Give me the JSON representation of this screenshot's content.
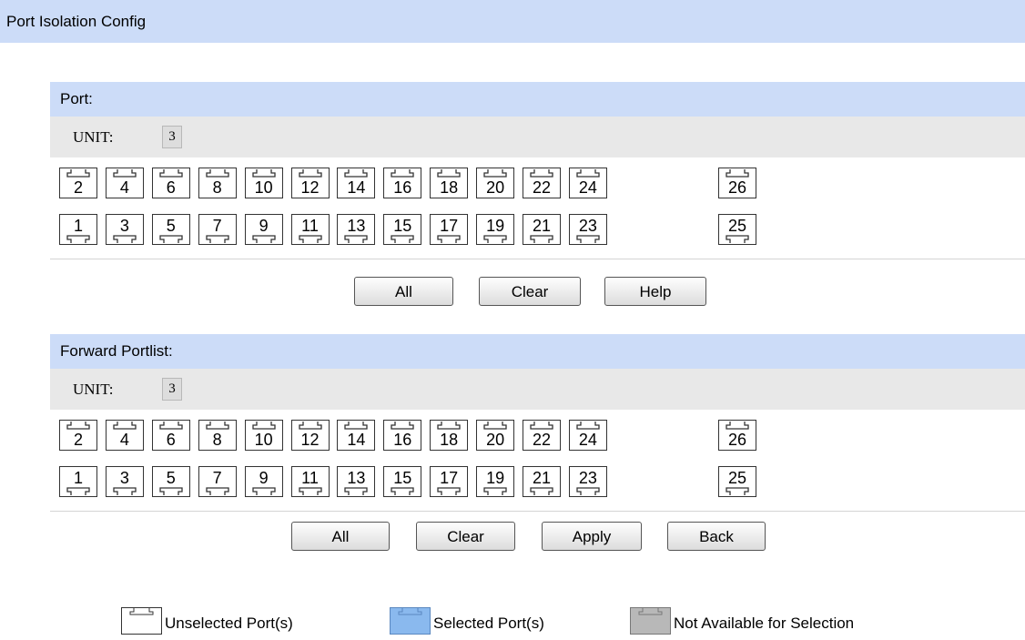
{
  "page_title": "Port Isolation Config",
  "port_section": {
    "header": "Port:",
    "unit_label": "UNIT:",
    "unit_value": "3",
    "buttons": {
      "all": "All",
      "clear": "Clear",
      "help": "Help"
    }
  },
  "forward_section": {
    "header": "Forward Portlist:",
    "unit_label": "UNIT:",
    "unit_value": "3",
    "buttons": {
      "all": "All",
      "clear": "Clear",
      "apply": "Apply",
      "back": "Back"
    }
  },
  "ports": {
    "top_row": [
      "2",
      "4",
      "6",
      "8",
      "10",
      "12",
      "14",
      "16",
      "18",
      "20",
      "22",
      "24"
    ],
    "bottom_row": [
      "1",
      "3",
      "5",
      "7",
      "9",
      "11",
      "13",
      "15",
      "17",
      "19",
      "21",
      "23"
    ],
    "extra_top": "26",
    "extra_bottom": "25"
  },
  "legend": {
    "unselected": "Unselected Port(s)",
    "selected": "Selected Port(s)",
    "unavailable": "Not Available for Selection"
  },
  "colors": {
    "header_bg": "#ccdcf8",
    "unit_row_bg": "#e8e8e8",
    "selected_port": "#8ab9ee",
    "unavailable_port": "#b8b8b8"
  }
}
